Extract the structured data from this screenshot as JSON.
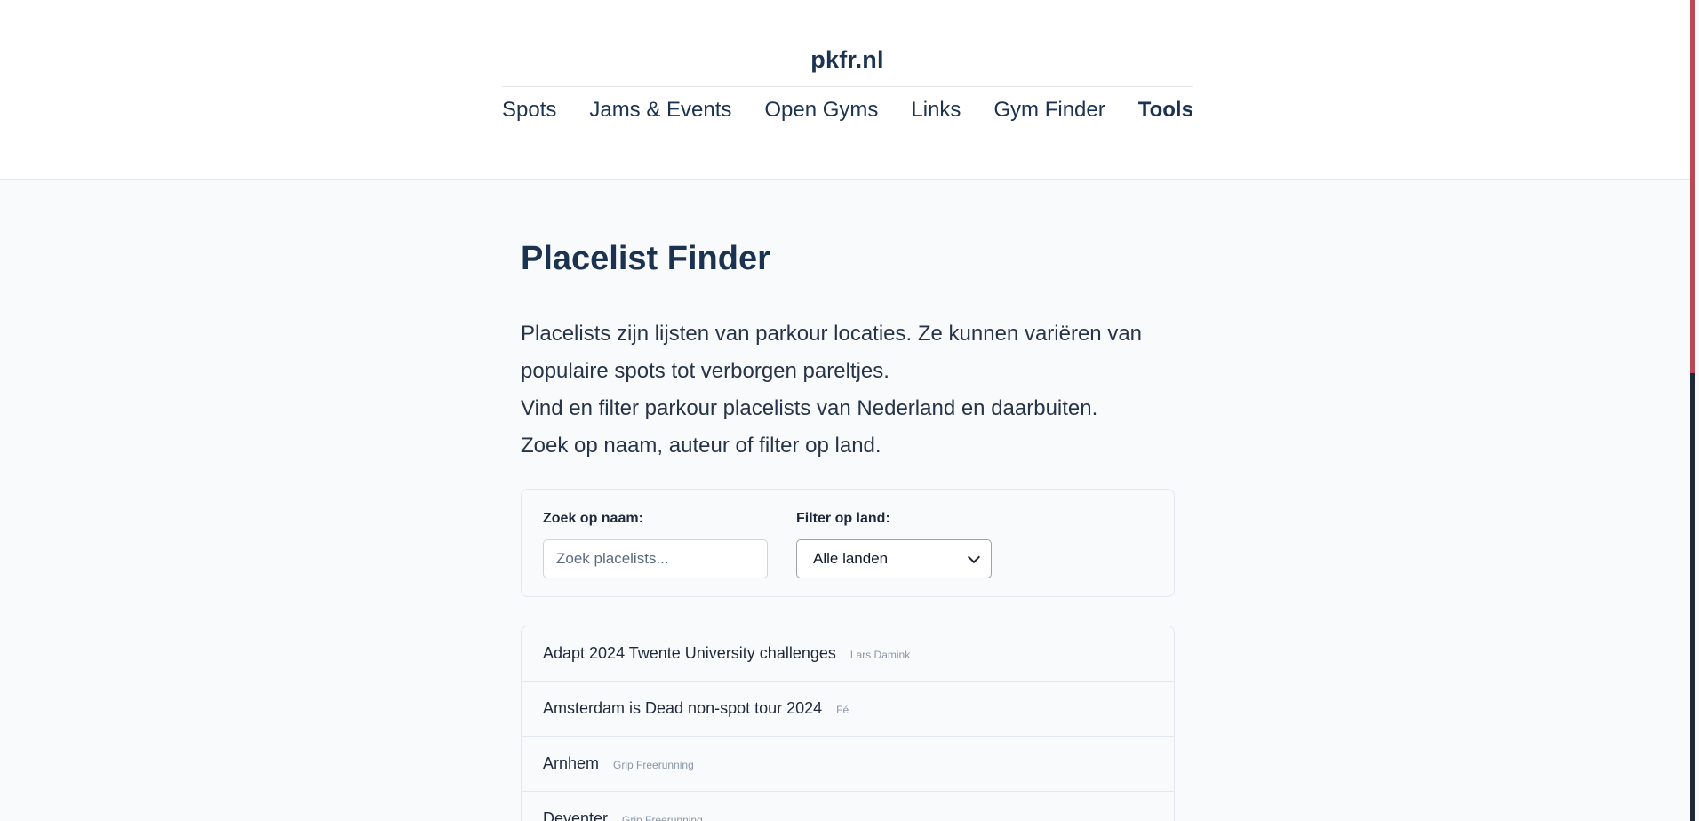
{
  "site": {
    "brand": "pkfr.nl"
  },
  "nav": {
    "items": [
      {
        "label": "Spots",
        "active": false
      },
      {
        "label": "Jams & Events",
        "active": false
      },
      {
        "label": "Open Gyms",
        "active": false
      },
      {
        "label": "Links",
        "active": false
      },
      {
        "label": "Gym Finder",
        "active": false
      },
      {
        "label": "Tools",
        "active": true
      }
    ]
  },
  "page": {
    "title": "Placelist Finder",
    "intro": [
      "Placelists zijn lijsten van parkour locaties. Ze kunnen variëren van populaire spots tot verborgen pareltjes.",
      "Vind en filter parkour placelists van Nederland en daarbuiten.",
      "Zoek op naam, auteur of filter op land."
    ]
  },
  "filters": {
    "search_label": "Zoek op naam:",
    "search_placeholder": "Zoek placelists...",
    "search_value": "",
    "country_label": "Filter op land:",
    "country_selected": "Alle landen"
  },
  "placelists": [
    {
      "name": "Adapt 2024 Twente University challenges",
      "author": "Lars Damink"
    },
    {
      "name": "Amsterdam is Dead non-spot tour 2024",
      "author": "Fé"
    },
    {
      "name": "Arnhem",
      "author": "Grip Freerunning"
    },
    {
      "name": "Deventer",
      "author": "Grip Freerunning"
    }
  ],
  "colors": {
    "primary_text": "#1b3350",
    "background": "#f8fafc",
    "border": "#e2e8f0",
    "muted": "#8a97a8"
  }
}
